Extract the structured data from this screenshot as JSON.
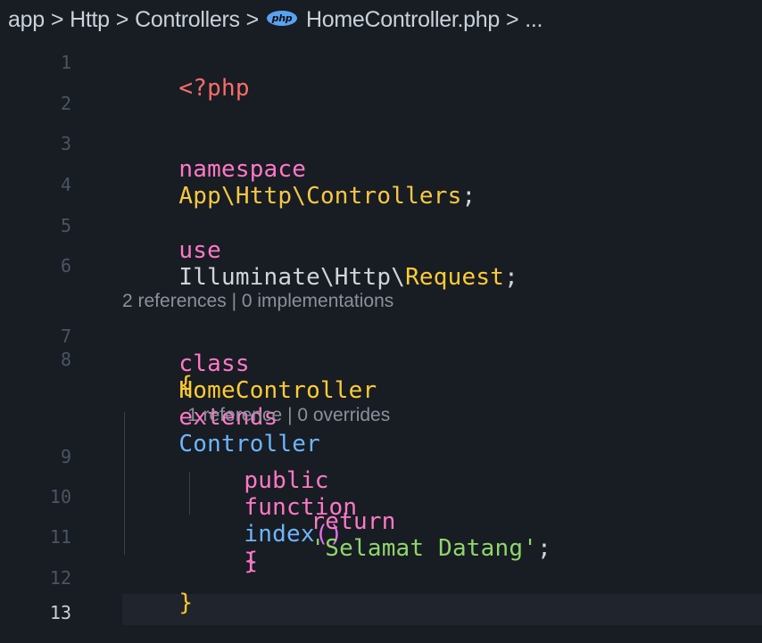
{
  "breadcrumb": {
    "items": [
      "app",
      "Http",
      "Controllers",
      "HomeController.php",
      "..."
    ],
    "separator": ">",
    "file_icon_text": "php"
  },
  "editor": {
    "line_numbers": [
      "1",
      "2",
      "3",
      "4",
      "5",
      "6",
      "7",
      "8",
      "9",
      "10",
      "11",
      "12",
      "13"
    ],
    "active_line": "13",
    "lines": {
      "l1": "<?php",
      "l3_kw": "namespace",
      "l3_ns": "App\\Http\\Controllers",
      "l3_end": ";",
      "l5_kw": "use",
      "l5_ns": "Illuminate\\Http\\",
      "l5_cls": "Request",
      "l5_end": ";",
      "l7_kw": "class",
      "l7_name": "HomeController",
      "l7_ext": "extends",
      "l7_parent": "Controller",
      "l8_brace": "{",
      "l9_mod": "public",
      "l9_kw": "function",
      "l9_name": "index",
      "l9_parens": "()",
      "l9_brace": "{",
      "l10_kw": "return",
      "l10_str": "'Selamat Datang'",
      "l10_end": ";",
      "l11_brace": "}",
      "l12_brace": "}"
    },
    "codelens": {
      "class_lens": "2 references | 0 implementations",
      "method_lens": "1 reference | 0 overrides"
    }
  },
  "colors": {
    "background": "#181c23",
    "keyword": "#ff79c6",
    "namespace": "#f7c843",
    "function": "#6cb6ff",
    "string": "#8fd66a"
  }
}
